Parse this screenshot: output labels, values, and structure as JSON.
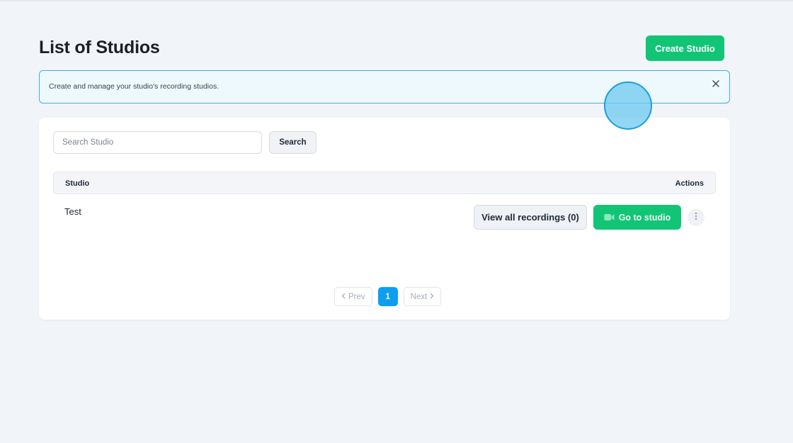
{
  "page": {
    "title": "List of Studios",
    "create_button_label": "Create Studio"
  },
  "info_banner": {
    "text": "Create and manage your studio's recording studios.",
    "close_icon": "close-icon"
  },
  "search": {
    "placeholder": "Search Studio",
    "value": "",
    "button_label": "Search"
  },
  "table": {
    "columns": [
      "Studio",
      "Actions"
    ],
    "rows": [
      {
        "name": "Test",
        "view_recordings_label": "View all recordings (0)",
        "go_to_studio_label": "Go to studio",
        "go_icon": "video-camera-icon",
        "more_icon": "vertical-dots-icon"
      }
    ]
  },
  "pagination": {
    "prev_label": "Prev",
    "current_page": "1",
    "next_label": "Next"
  },
  "colors": {
    "primary_green": "#12c576",
    "info_border": "#3db4cf",
    "pagination_active": "#0d9ef2"
  }
}
